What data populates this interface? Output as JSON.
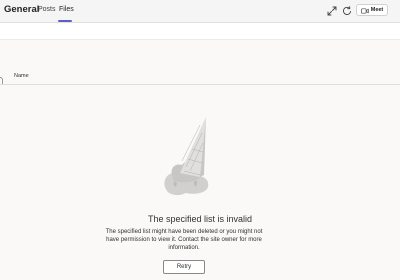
{
  "header": {
    "channel_title": "General",
    "tabs": [
      {
        "label": "Posts",
        "active": false
      },
      {
        "label": "Files",
        "active": true
      }
    ],
    "meet_label": "Meet",
    "icons": [
      "expand-icon",
      "refresh-icon",
      "video-camera-icon"
    ]
  },
  "list": {
    "columns": [
      {
        "label": "Name"
      }
    ]
  },
  "empty_state": {
    "title": "The specified list is invalid",
    "description": "The specified list might have been deleted or you might not have permission to view it. Contact the site owner for more information.",
    "retry_label": "Retry",
    "illustration": "melted-ice-cream-cone"
  },
  "colors": {
    "accent": "#5b5fc7",
    "background": "#faf9f8"
  }
}
